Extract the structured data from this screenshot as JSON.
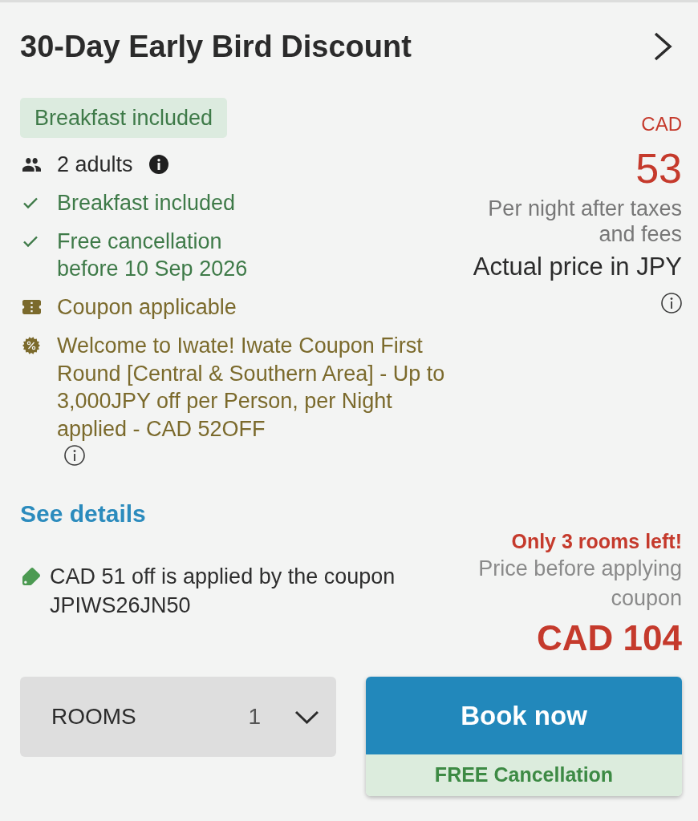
{
  "offer": {
    "title": "30-Day Early Bird Discount"
  },
  "badge": {
    "label": "Breakfast included"
  },
  "features": [
    {
      "kind": "guests",
      "text": "2 adults",
      "info": true
    },
    {
      "kind": "included",
      "text": "Breakfast included"
    },
    {
      "kind": "included",
      "text": "Free cancellation\nbefore 10 Sep 2026"
    },
    {
      "kind": "coupon",
      "text": "Coupon applicable"
    },
    {
      "kind": "promo",
      "text": "Welcome to Iwate! Iwate Coupon First Round [Central & Southern Area] - Up to 3,000JPY off per Person, per Night applied - CAD 52OFF",
      "info": true
    }
  ],
  "price": {
    "currency": "CAD",
    "amount": "53",
    "note": "Per night after taxes and fees",
    "actual": "Actual price in JPY",
    "info": true
  },
  "see_details": "See details",
  "coupon_note": "CAD 51 off is applied by the coupon JPIWS26JN50",
  "availability": "Only 3 rooms left!",
  "original_price": {
    "label": "Price before applying coupon",
    "amount": "CAD 104"
  },
  "rooms": {
    "label": "ROOMS",
    "value": "1"
  },
  "book": {
    "label": "Book now",
    "note": "FREE Cancellation"
  }
}
